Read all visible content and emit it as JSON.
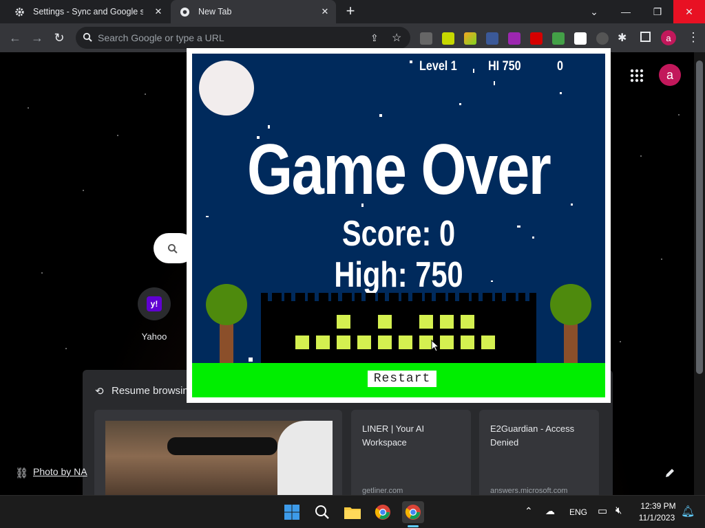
{
  "browser": {
    "tabs": [
      {
        "label": "Settings - Sync and Google servi",
        "active": false
      },
      {
        "label": "New Tab",
        "active": true
      }
    ],
    "omnibox": {
      "placeholder": "Search Google or type a URL"
    }
  },
  "ntp": {
    "profile_initial": "a",
    "shortcuts": [
      {
        "label": "Yahoo",
        "logo_text": "y!"
      }
    ],
    "resume": {
      "title": "Resume browsing",
      "cards": [
        {
          "title": "LINER | Your AI Workspace",
          "domain": "getliner.com"
        },
        {
          "title": "E2Guardian - Access Denied",
          "domain": "answers.microsoft.com"
        }
      ]
    },
    "photo_credit": "Photo by NA"
  },
  "game": {
    "hud": {
      "level": "Level 1",
      "hi": "HI 750",
      "score": "0"
    },
    "headline": "Game Over",
    "score_line": "Score: 0",
    "high_line": "High: 750",
    "restart_label": "Restart"
  },
  "taskbar": {
    "lang": "ENG",
    "time": "12:39 PM",
    "date": "11/1/2023"
  },
  "colors": {
    "sky": "#002a5c",
    "ground": "#00ee00",
    "window_light": "#d4f050",
    "accent_profile": "#c2185b"
  }
}
